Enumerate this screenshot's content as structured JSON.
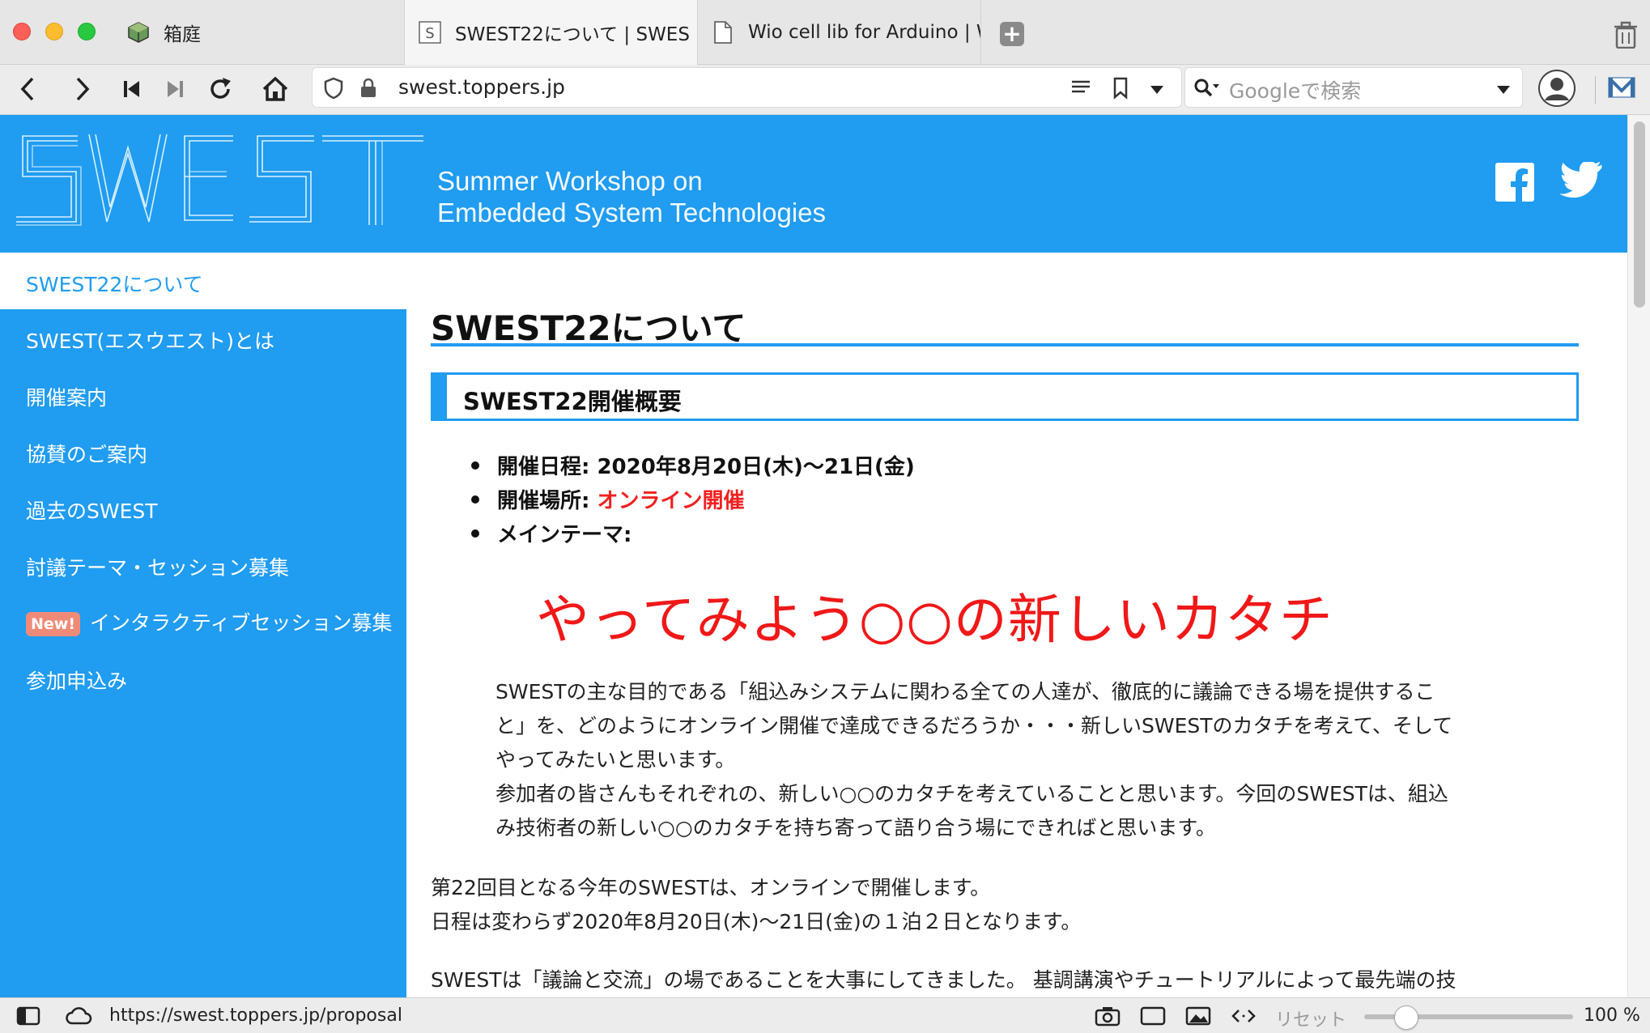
{
  "tabs": [
    {
      "label": "箱庭",
      "icon": "app-cube-icon"
    },
    {
      "label": "SWEST22について | SWES",
      "icon": "swest-s-icon"
    },
    {
      "label": "Wio cell lib for Arduino | Wi",
      "icon": "page-icon"
    }
  ],
  "toolbar": {
    "url": "swest.toppers.jp",
    "search_placeholder": "Googleで検索"
  },
  "header": {
    "logo_text": "SWEST",
    "tagline_line1": "Summer Workshop on",
    "tagline_line2": "Embedded System Technologies"
  },
  "sidebar": {
    "current": "SWEST22について",
    "items": [
      {
        "label": "SWEST(エスウエスト)とは"
      },
      {
        "label": "開催案内"
      },
      {
        "label": "協賛のご案内"
      },
      {
        "label": "過去のSWEST"
      },
      {
        "label": "討議テーマ・セッション募集"
      },
      {
        "label": "インタラクティブセッション募集",
        "badge": "New!"
      },
      {
        "label": "参加申込み"
      }
    ]
  },
  "main": {
    "title": "SWEST22について",
    "section_title": "SWEST22開催概要",
    "bullets": [
      {
        "label": "開催日程:",
        "value": "2020年8月20日(木)〜21日(金)"
      },
      {
        "label": "開催場所:",
        "value": "オンライン開催"
      },
      {
        "label": "メインテーマ:",
        "value": ""
      }
    ],
    "theme": "やってみよう○○の新しいカタチ",
    "paragraph_lines": [
      "SWESTの主な目的である「組込みシステムに関わる全ての人達が、徹底的に議論できる場を提供するこ",
      "と」を、どのようにオンライン開催で達成できるだろうか・・・新しいSWESTのカタチを考えて、そして",
      "やってみたいと思います。",
      "参加者の皆さんもそれぞれの、新しい○○のカタチを考えていることと思います。今回のSWESTは、組込",
      "み技術者の新しい○○のカタチを持ち寄って語り合う場にできればと思います。"
    ],
    "paragraph2_lines": [
      "第22回目となる今年のSWESTは、オンラインで開催します。",
      "日程は変わらず2020年8月20日(木)〜21日(金)の１泊２日となります。"
    ],
    "paragraph3": "SWESTは「議論と交流」の場であることを大事にしてきました。 基調講演やチュートリアルによって最先端の技"
  },
  "statusbar": {
    "link_url": "https://swest.toppers.jp/proposal",
    "reset_label": "リセット",
    "zoom": "100 %"
  },
  "colors": {
    "brand_blue": "#209cf0",
    "highlight_red": "#f02020",
    "new_badge": "#f08a78"
  }
}
